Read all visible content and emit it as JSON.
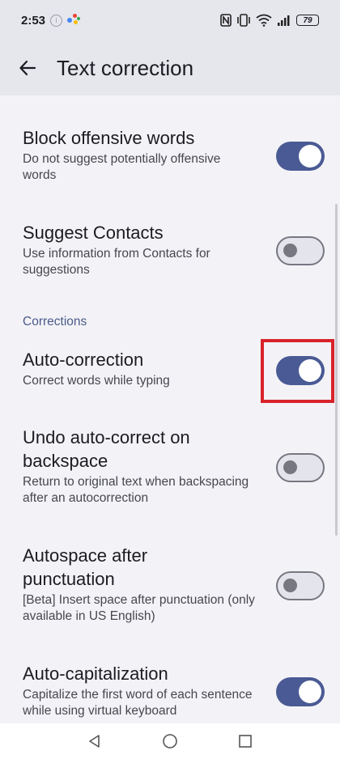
{
  "status_bar": {
    "time": "2:53",
    "battery": "79"
  },
  "header": {
    "title": "Text correction",
    "back_icon": "arrow-back-icon"
  },
  "settings": {
    "block_offensive": {
      "title": "Block offensive words",
      "summary": "Do not suggest potentially offensive words",
      "enabled": true
    },
    "suggest_contacts": {
      "title": "Suggest Contacts",
      "summary": "Use information from Contacts for suggestions",
      "enabled": false
    },
    "corrections_header": "Corrections",
    "auto_correction": {
      "title": "Auto-correction",
      "summary": "Correct words while typing",
      "enabled": true
    },
    "undo_autocorrect": {
      "title": "Undo auto-correct on backspace",
      "summary": "Return to original text when backspacing after an autocorrection",
      "enabled": false
    },
    "autospace": {
      "title": "Autospace after punctuation",
      "summary": "[Beta] Insert space after punctuation (only available in US English)",
      "enabled": false
    },
    "auto_capitalization": {
      "title": "Auto-capitalization",
      "summary": "Capitalize the first word of each sentence while using virtual keyboard",
      "enabled": true
    }
  },
  "colors": {
    "toggle_on": "#4a5a94",
    "toggle_off": "#e4e4ec",
    "highlight": "#d8232a",
    "section_header": "#4a5a8a"
  },
  "nav_bar": {
    "back": "triangle-back-icon",
    "home": "circle-home-icon",
    "recents": "square-recents-icon"
  }
}
